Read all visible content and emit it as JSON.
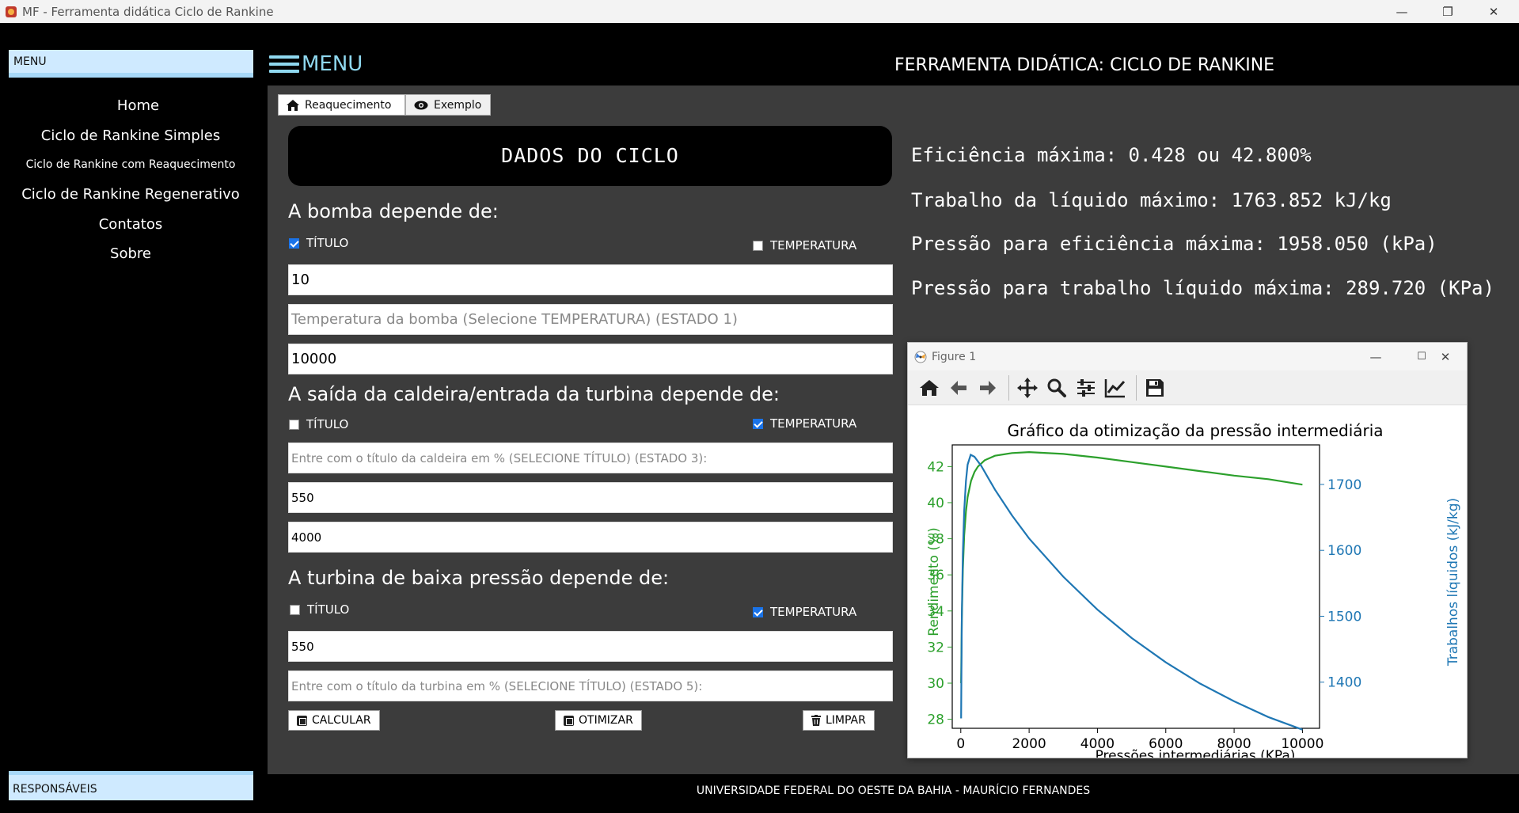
{
  "window": {
    "title": "MF - Ferramenta didática Ciclo de Rankine",
    "min_glyph": "—",
    "max_glyph": "❐",
    "close_glyph": "✕"
  },
  "sidebar": {
    "header": "MENU",
    "items": [
      {
        "label": "Home"
      },
      {
        "label": "Ciclo de Rankine Simples"
      },
      {
        "label": "Ciclo de Rankine com Reaquecimento"
      },
      {
        "label": "Ciclo de Rankine Regenerativo"
      },
      {
        "label": "Contatos"
      },
      {
        "label": "Sobre"
      }
    ],
    "footer": "RESPONSÁVEIS"
  },
  "header": {
    "menu_label": "MENU",
    "title": "FERRAMENTA DIDÁTICA: CICLO DE RANKINE"
  },
  "tabs": [
    {
      "label": "Reaquecimento",
      "icon": "home-icon"
    },
    {
      "label": "Exemplo",
      "icon": "eye-icon"
    }
  ],
  "form": {
    "title": "DADOS DO CICLO",
    "pump": {
      "label": "A bomba depende de:",
      "opt1": "TÍTULO",
      "opt1_checked": true,
      "opt2": "TEMPERATURA",
      "opt2_checked": false,
      "field1_value": "10",
      "field2_placeholder": "Temperatura da bomba (Selecione TEMPERATURA) (ESTADO 1)",
      "field3_value": "10000"
    },
    "boiler": {
      "label": "A saída da caldeira/entrada da turbina depende de:",
      "opt1": "TÍTULO",
      "opt1_checked": false,
      "opt2": "TEMPERATURA",
      "opt2_checked": true,
      "field1_placeholder": "Entre com o título da caldeira em % (SELECIONE TÍTULO) (ESTADO 3):",
      "field2_value": "550",
      "field3_value": "4000"
    },
    "low_turbine": {
      "label": "A turbina de baixa pressão depende de:",
      "opt1": "TÍTULO",
      "opt1_checked": false,
      "opt2": "TEMPERATURA",
      "opt2_checked": true,
      "field1_value": "550",
      "field2_placeholder": "Entre com o título da turbina em % (SELECIONE TÍTULO) (ESTADO 5):"
    },
    "buttons": {
      "calcular": "CALCULAR",
      "otimizar": "OTIMIZAR",
      "limpar": "LIMPAR"
    }
  },
  "results": [
    "Eficiência máxima: 0.428 ou 42.800%",
    "Trabalho da líquido máximo: 1763.852 kJ/kg",
    "Pressão para eficiência máxima: 1958.050 (kPa)",
    "Pressão para trabalho líquido máxima: 289.720 (KPa)"
  ],
  "figure": {
    "window_title": "Figure 1",
    "toolbar": [
      "home-icon",
      "back-arrow-icon",
      "forward-arrow-icon",
      "pan-icon",
      "zoom-icon",
      "configure-subplots-icon",
      "edit-axis-icon",
      "save-icon"
    ]
  },
  "chart_data": {
    "type": "line",
    "title": "Gráfico da otimização da pressão intermediária",
    "xlabel": "Pressões intermediárias (KPa)",
    "ylabel": "Rendimento (%)",
    "y2label": "Trabalhos líquidos (kJ/kg)",
    "xlim": [
      -250,
      10500
    ],
    "ylim": [
      27.5,
      43.2
    ],
    "y2lim": [
      1330,
      1760
    ],
    "x_ticks": [
      0,
      2000,
      4000,
      6000,
      8000,
      10000
    ],
    "y_ticks": [
      28,
      30,
      32,
      34,
      36,
      38,
      40,
      42
    ],
    "y2_ticks": [
      1400,
      1500,
      1600,
      1700
    ],
    "grid": false,
    "colors": {
      "left": "#2ca02c",
      "right": "#1f77b4"
    },
    "series": [
      {
        "axis": "left",
        "x": [
          10,
          30,
          60,
          100,
          150,
          200,
          300,
          400,
          500,
          700,
          1000,
          1500,
          2000,
          3000,
          4000,
          5000,
          6000,
          7000,
          8000,
          9000,
          10000
        ],
        "values": [
          30.0,
          33.5,
          36.3,
          38.2,
          39.5,
          40.3,
          41.2,
          41.7,
          42.0,
          42.35,
          42.6,
          42.75,
          42.8,
          42.7,
          42.5,
          42.25,
          42.0,
          41.75,
          41.5,
          41.3,
          41.0
        ]
      },
      {
        "axis": "right",
        "x": [
          10,
          30,
          60,
          100,
          150,
          200,
          290,
          400,
          600,
          800,
          1000,
          1500,
          2000,
          3000,
          4000,
          5000,
          6000,
          7000,
          8000,
          9000,
          10000
        ],
        "values": [
          1345,
          1500,
          1595,
          1660,
          1705,
          1730,
          1745,
          1742,
          1728,
          1710,
          1692,
          1653,
          1618,
          1560,
          1510,
          1467,
          1430,
          1398,
          1371,
          1347,
          1328
        ]
      }
    ]
  }
}
